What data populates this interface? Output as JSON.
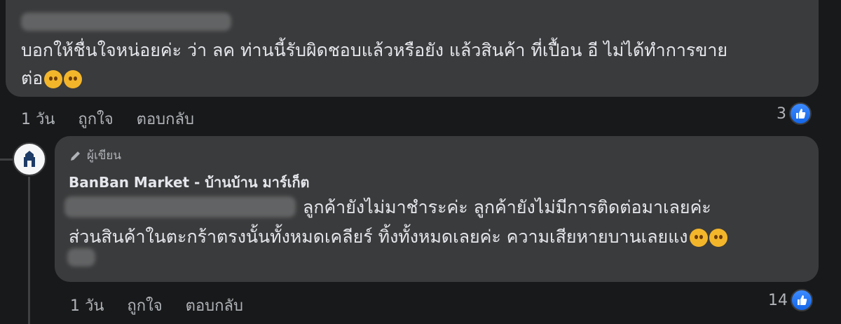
{
  "comment1": {
    "text_line1": "บอกให้ชื่นใจหน่อยค่ะ ว่า ลค ท่านนี้รับผิดชอบแล้วหรือยัง แล้วสินค้า ที่เปื้อน อี ไม่ได้ทำการขาย",
    "text_line2": "ต่อ",
    "emojis": [
      "sad-face-emoji",
      "crying-face-emoji"
    ],
    "time": "1 วัน",
    "like_label": "ถูกใจ",
    "reply_label": "ตอบกลับ",
    "like_count": "3"
  },
  "comment2": {
    "badge": "ผู้เขียน",
    "author": "BanBan Market - บ้านบ้าน มาร์เก็ต",
    "text_line1": "ลูกค้ายังไม่มาชำระค่ะ ลูกค้ายังไม่มีการติดต่อมาเลยค่ะ",
    "text_line2": "ส่วนสินค้าในตะกร้าตรงนั้นทั้งหมดเคลียร์ ทิ้งทั้งหมดเลยค่ะ ความเสียหายบานเลยแง",
    "emojis": [
      "loudly-crying-face-emoji",
      "loudly-crying-face-emoji"
    ],
    "time": "1 วัน",
    "like_label": "ถูกใจ",
    "reply_label": "ตอบกลับ",
    "like_count": "14"
  },
  "colors": {
    "background": "#18191a",
    "bubble": "#3a3b3c",
    "like_blue": "#1877f2",
    "secondary_text": "#b0b3b8"
  }
}
